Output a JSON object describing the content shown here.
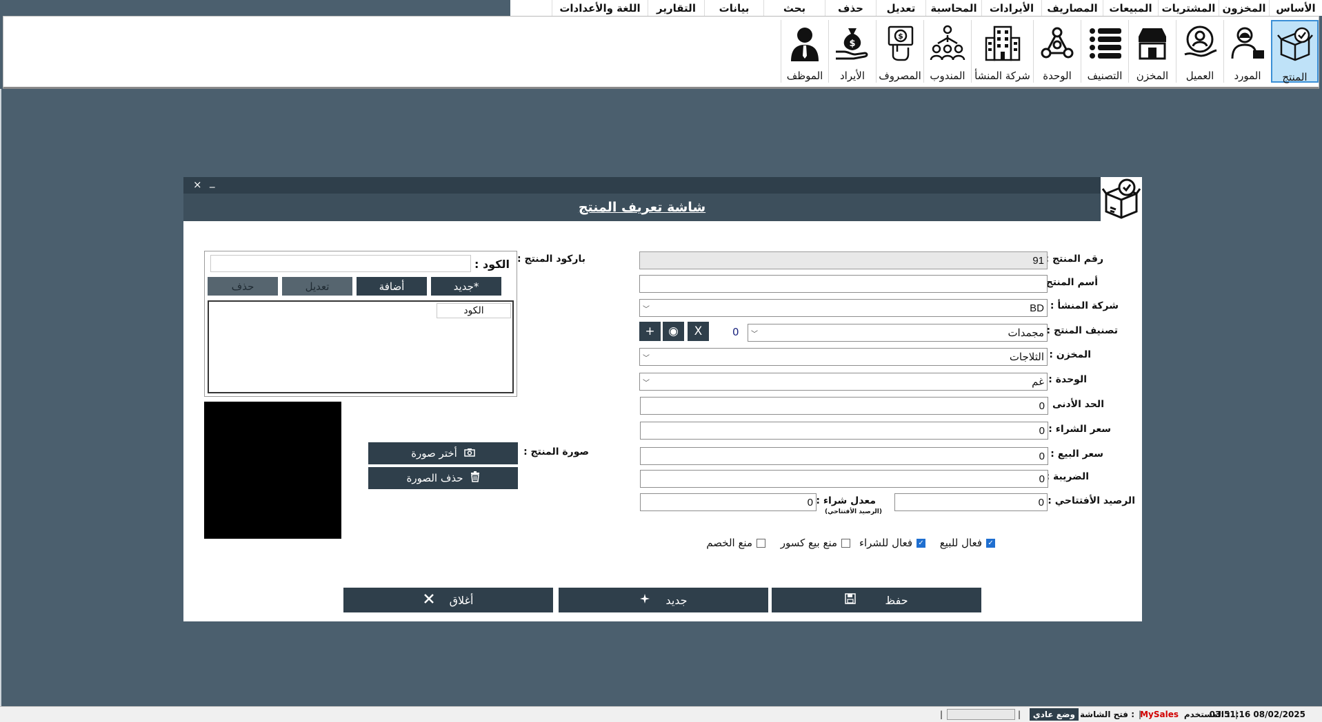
{
  "menu": {
    "items": [
      "الأساس",
      "المخزون",
      "المشتريات",
      "المبيعات",
      "المصاريف",
      "الأيرادات",
      "المحاسبة",
      "تعديل",
      "حذف",
      "بحث",
      "بيانات",
      "التقارير",
      "اللغة والأعدادات"
    ]
  },
  "ribbon": {
    "buttons": [
      {
        "label": "المنتج",
        "icon": "product-box-icon",
        "active": true
      },
      {
        "label": "المورد",
        "icon": "supplier-icon"
      },
      {
        "label": "العميل",
        "icon": "customer-icon"
      },
      {
        "label": "المخزن",
        "icon": "store-icon"
      },
      {
        "label": "التصنيف",
        "icon": "list-icon"
      },
      {
        "label": "الوحدة",
        "icon": "unit-nodes-icon"
      },
      {
        "label": "شركة المنشأ",
        "icon": "building-icon"
      },
      {
        "label": "المندوب",
        "icon": "team-icon"
      },
      {
        "label": "المصروف",
        "icon": "expense-hand-icon"
      },
      {
        "label": "الأيراد",
        "icon": "income-bag-icon"
      },
      {
        "label": "الموظف",
        "icon": "employee-icon"
      }
    ]
  },
  "dialog": {
    "title": "شاشة تعريف المنتج",
    "minimize": "_",
    "close": "×",
    "labels": {
      "product_no": "رقم المنتج :",
      "product_name": "أسم المنتج :",
      "origin_company": "شركة المنشأ :",
      "category": "تصنيف المنتج :",
      "store": "المخزن :",
      "unit": "الوحدة :",
      "min_limit": "الحد الأدنى :",
      "buy_price": "سعر الشراء :",
      "sell_price": "سعر البيع :",
      "tax": "الضريبة :",
      "opening_balance": "الرصيد الأفتتاحي :",
      "purchase_rate": "معدل شراء :",
      "purchase_rate_note": "(الرصيد الأفتتاحي)",
      "barcode": "باركود المنتج :",
      "image": "صورة المنتج :"
    },
    "values": {
      "product_no": "91",
      "product_name": "",
      "origin_company": "BD",
      "category": "مجمدات",
      "category_count": "0",
      "store": "الثلاجات",
      "unit": "غم",
      "min_limit": "0",
      "buy_price": "0",
      "sell_price": "0",
      "tax": "0",
      "opening_balance": "0",
      "purchase_rate": "0"
    },
    "category_buttons": {
      "remove": "X",
      "view": "◉",
      "add": "+"
    },
    "barcode_panel": {
      "code_label": "الكود :",
      "code_value": "",
      "new": "جديد*",
      "add": "أضافة",
      "edit": "تعديل",
      "delete": "حذف",
      "column": "الكود"
    },
    "image_buttons": {
      "choose": "أختر صورة",
      "delete": "حذف الصورة"
    },
    "checkboxes": [
      {
        "label": "فعال للبيع",
        "checked": true
      },
      {
        "label": "فعال للشراء",
        "checked": true
      },
      {
        "label": "منع بيع كسور",
        "checked": false
      },
      {
        "label": "منع الخصم",
        "checked": false
      }
    ],
    "actions": {
      "save": "حفظ",
      "new": "جديد",
      "close": "أغلاق"
    }
  },
  "status": {
    "datetime": "03:51:16 08/02/2025",
    "user_label": "المستخدم :",
    "user": "MySales",
    "open_label": "فتح الشاشة :",
    "mode": "وضع عادي"
  },
  "colors": {
    "dark": "#2f3f4b",
    "title": "#3d4f5c",
    "desktop": "#4b5f6e",
    "active": "#bfe2f8",
    "user": "#d10000"
  }
}
